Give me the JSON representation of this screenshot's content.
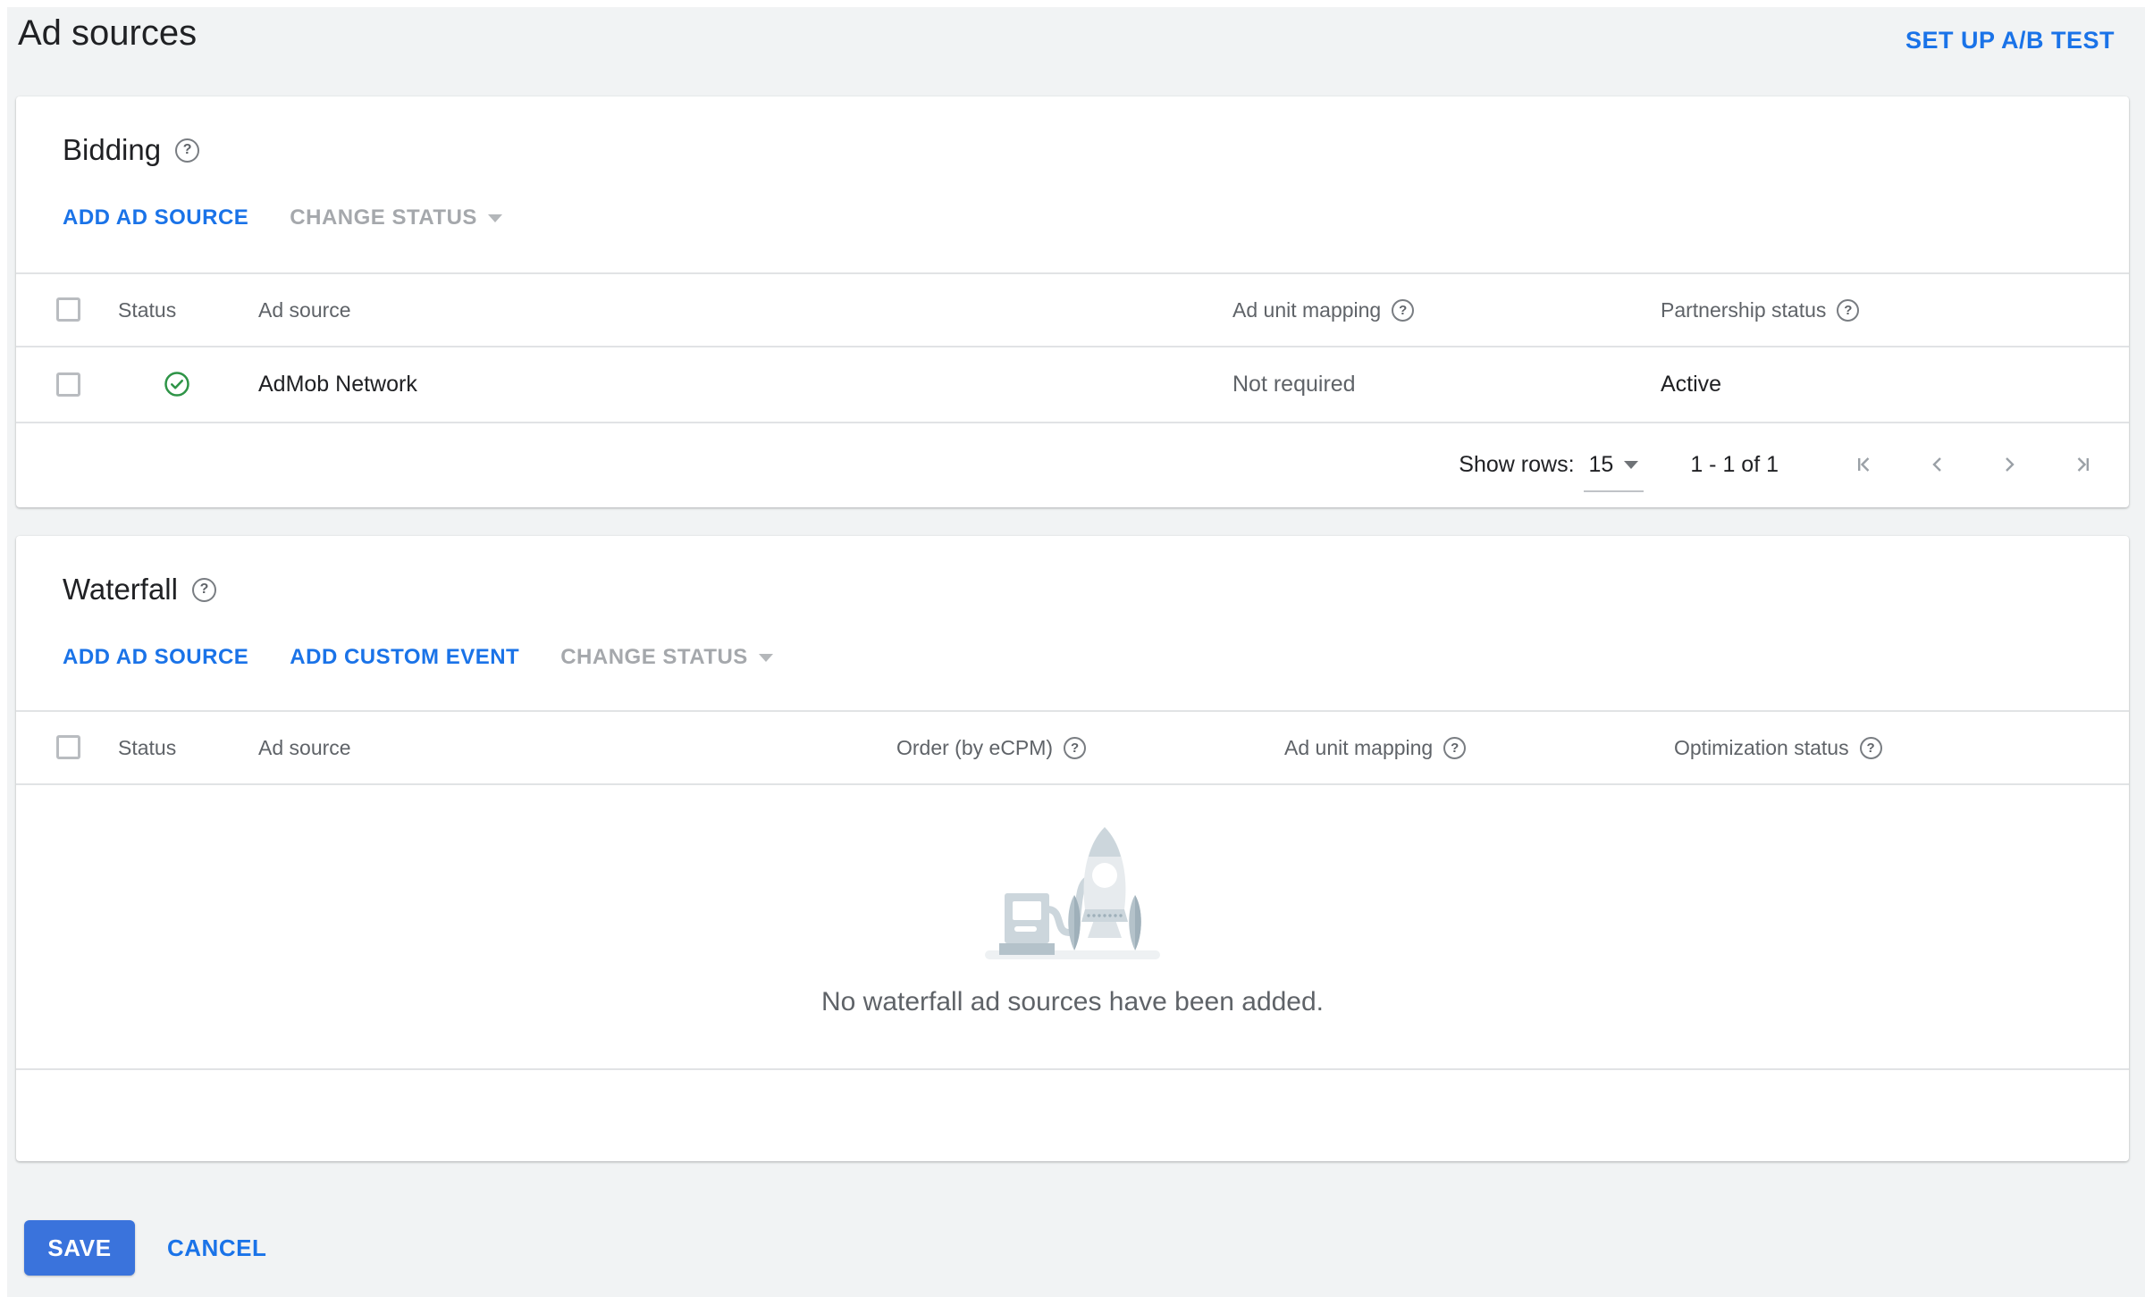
{
  "header": {
    "title": "Ad sources",
    "ab_test_link": "SET UP A/B TEST"
  },
  "bidding": {
    "title": "Bidding",
    "actions": {
      "add_ad_source": "ADD AD SOURCE",
      "change_status": "CHANGE STATUS"
    },
    "columns": {
      "status": "Status",
      "ad_source": "Ad source",
      "ad_unit_mapping": "Ad unit mapping",
      "partnership_status": "Partnership status"
    },
    "row": {
      "status": "active",
      "ad_source": "AdMob Network",
      "ad_unit_mapping": "Not required",
      "partnership_status": "Active"
    },
    "pagination": {
      "show_rows_label": "Show rows:",
      "rows_per_page": "15",
      "range": "1 - 1 of 1"
    }
  },
  "waterfall": {
    "title": "Waterfall",
    "actions": {
      "add_ad_source": "ADD AD SOURCE",
      "add_custom_event": "ADD CUSTOM EVENT",
      "change_status": "CHANGE STATUS"
    },
    "columns": {
      "status": "Status",
      "ad_source": "Ad source",
      "order": "Order (by eCPM)",
      "ad_unit_mapping": "Ad unit mapping",
      "optimization_status": "Optimization status"
    },
    "empty_message": "No waterfall ad sources have been added."
  },
  "footer": {
    "save": "SAVE",
    "cancel": "CANCEL"
  },
  "icons": {
    "help_glyph": "?"
  },
  "colors": {
    "link_blue": "#1a73e8",
    "save_blue": "#3a73dc",
    "status_green": "#2e9447",
    "text_primary": "#202124",
    "text_secondary": "#5f6368",
    "disabled_gray": "#a5a8ac",
    "page_bg": "#f1f3f4"
  }
}
